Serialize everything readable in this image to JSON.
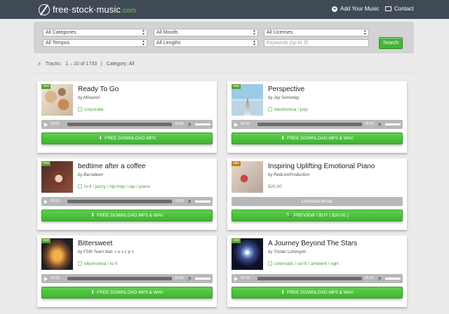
{
  "header": {
    "logo_text": "free·stock·music",
    "logo_domain": ".com",
    "add_music_label": "Add Your Music",
    "contact_label": "Contact"
  },
  "filters": {
    "categories": "All Categories",
    "moods": "All Moods",
    "licenses": "All Licenses",
    "tempos": "All Tempos",
    "lengths": "All Lengths",
    "keywords_placeholder": "Keywords (up to 3)",
    "search_label": "Search"
  },
  "tracks_info": {
    "label": "Tracks:",
    "range": "1 – 10 of 1733",
    "separator": "|",
    "category": "Category: All"
  },
  "player": {
    "time_start": "00:00",
    "time_end": "00:00"
  },
  "tracks": [
    {
      "badge": "new",
      "title": "Ready To Go",
      "artist": "by Mixaund",
      "tags": "corporate",
      "button": "FREE DOWNLOAD  MP3"
    },
    {
      "badge": "new",
      "title": "Perspective",
      "artist": "by Jay Someday",
      "tags": "electronica / pop",
      "button": "FREE DOWNLOAD  MP3 & WAV"
    },
    {
      "badge": "new",
      "title": "bedtime after a coffee",
      "artist": "by Barradeen",
      "tags": "lo-fi / jazzy / hip-hop / rap / piano",
      "button": "FREE DOWNLOAD  MP3 & WAV"
    },
    {
      "badge": "sale",
      "title": "Inspiring Uplifting Emotional Piano",
      "artist": "by RedLionProduction",
      "price": "$20.00",
      "licensed": "Licensed Music",
      "button": "PREVIEW / BUY ( $20.00 )"
    },
    {
      "badge": "new",
      "title": "Bittersweet",
      "artist": "by FSM Team feat. < e s c p >",
      "tags": "electronica / lo-fi",
      "button": "FREE DOWNLOAD  MP3 & WAV"
    },
    {
      "badge": "new",
      "title": "A Journey Beyond The Stars",
      "artist": "by Tristan Lohengrin",
      "tags": "cinematic / sci-fi / ambient / vgm",
      "button": "FREE DOWNLOAD  MP3 & WAV"
    }
  ],
  "colors": {
    "header_bg": "#3f4a55",
    "accent_green": "#45b43a",
    "tag_green": "#4b9e3a"
  }
}
